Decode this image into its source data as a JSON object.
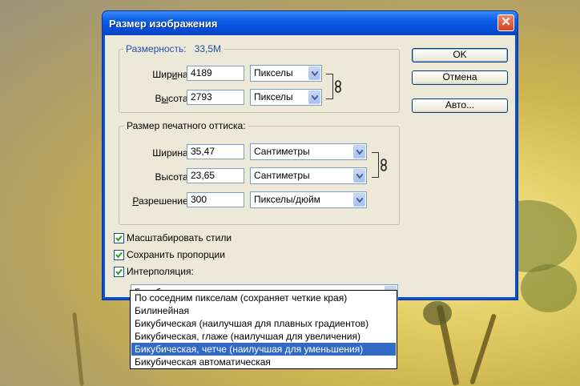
{
  "dialog": {
    "title": "Размер изображения",
    "close_glyph": "✕"
  },
  "pixel_dimensions": {
    "legend_label": "Размерность:",
    "size_value": "33,5M",
    "width_label_pre": "Шир",
    "width_label_u": "и",
    "width_label_post": "на:",
    "width_value": "4189",
    "width_unit": "Пикселы",
    "height_label_pre": "В",
    "height_label_u": "ы",
    "height_label_post": "сота:",
    "height_value": "2793",
    "height_unit": "Пикселы"
  },
  "document_size": {
    "legend_label": "Размер печатного оттиска:",
    "width_label": "Ширина:",
    "width_value": "35,47",
    "width_unit": "Сантиметры",
    "height_label": "Высота:",
    "height_value": "23,65",
    "height_unit": "Сантиметры",
    "resolution_label_pre": "",
    "resolution_label_u": "Р",
    "resolution_label_post": "азрешение:",
    "resolution_value": "300",
    "resolution_unit": "Пикселы/дюйм"
  },
  "buttons": {
    "ok": "OK",
    "cancel": "Отмена",
    "auto": "Авто..."
  },
  "checkboxes": {
    "scale_styles": "Масштабировать стили",
    "constrain_proportions": "Сохранить пропорции",
    "resample": "Интерполяция:"
  },
  "resample_select": {
    "selected": "Бикубическая автоматическая",
    "options": [
      "По соседним пикселам (сохраняет четкие края)",
      "Билинейная",
      "Бикубическая (наилучшая для плавных градиентов)",
      "Бикубическая, глаже (наилучшая для увеличения)",
      "Бикубическая, четче (наилучшая для уменьшения)",
      "Бикубическая автоматическая"
    ],
    "highlighted_index": 4
  },
  "colors": {
    "titlebar": "#0a5de6",
    "dialog_bg": "#ece9d8",
    "accent_text": "#1f4fa8",
    "highlight": "#316ac5",
    "close": "#d2451e"
  },
  "icons": {
    "close": "close-icon",
    "dropdown": "chevron-down-icon",
    "chain": "chain-link-icon",
    "check": "check-icon"
  }
}
